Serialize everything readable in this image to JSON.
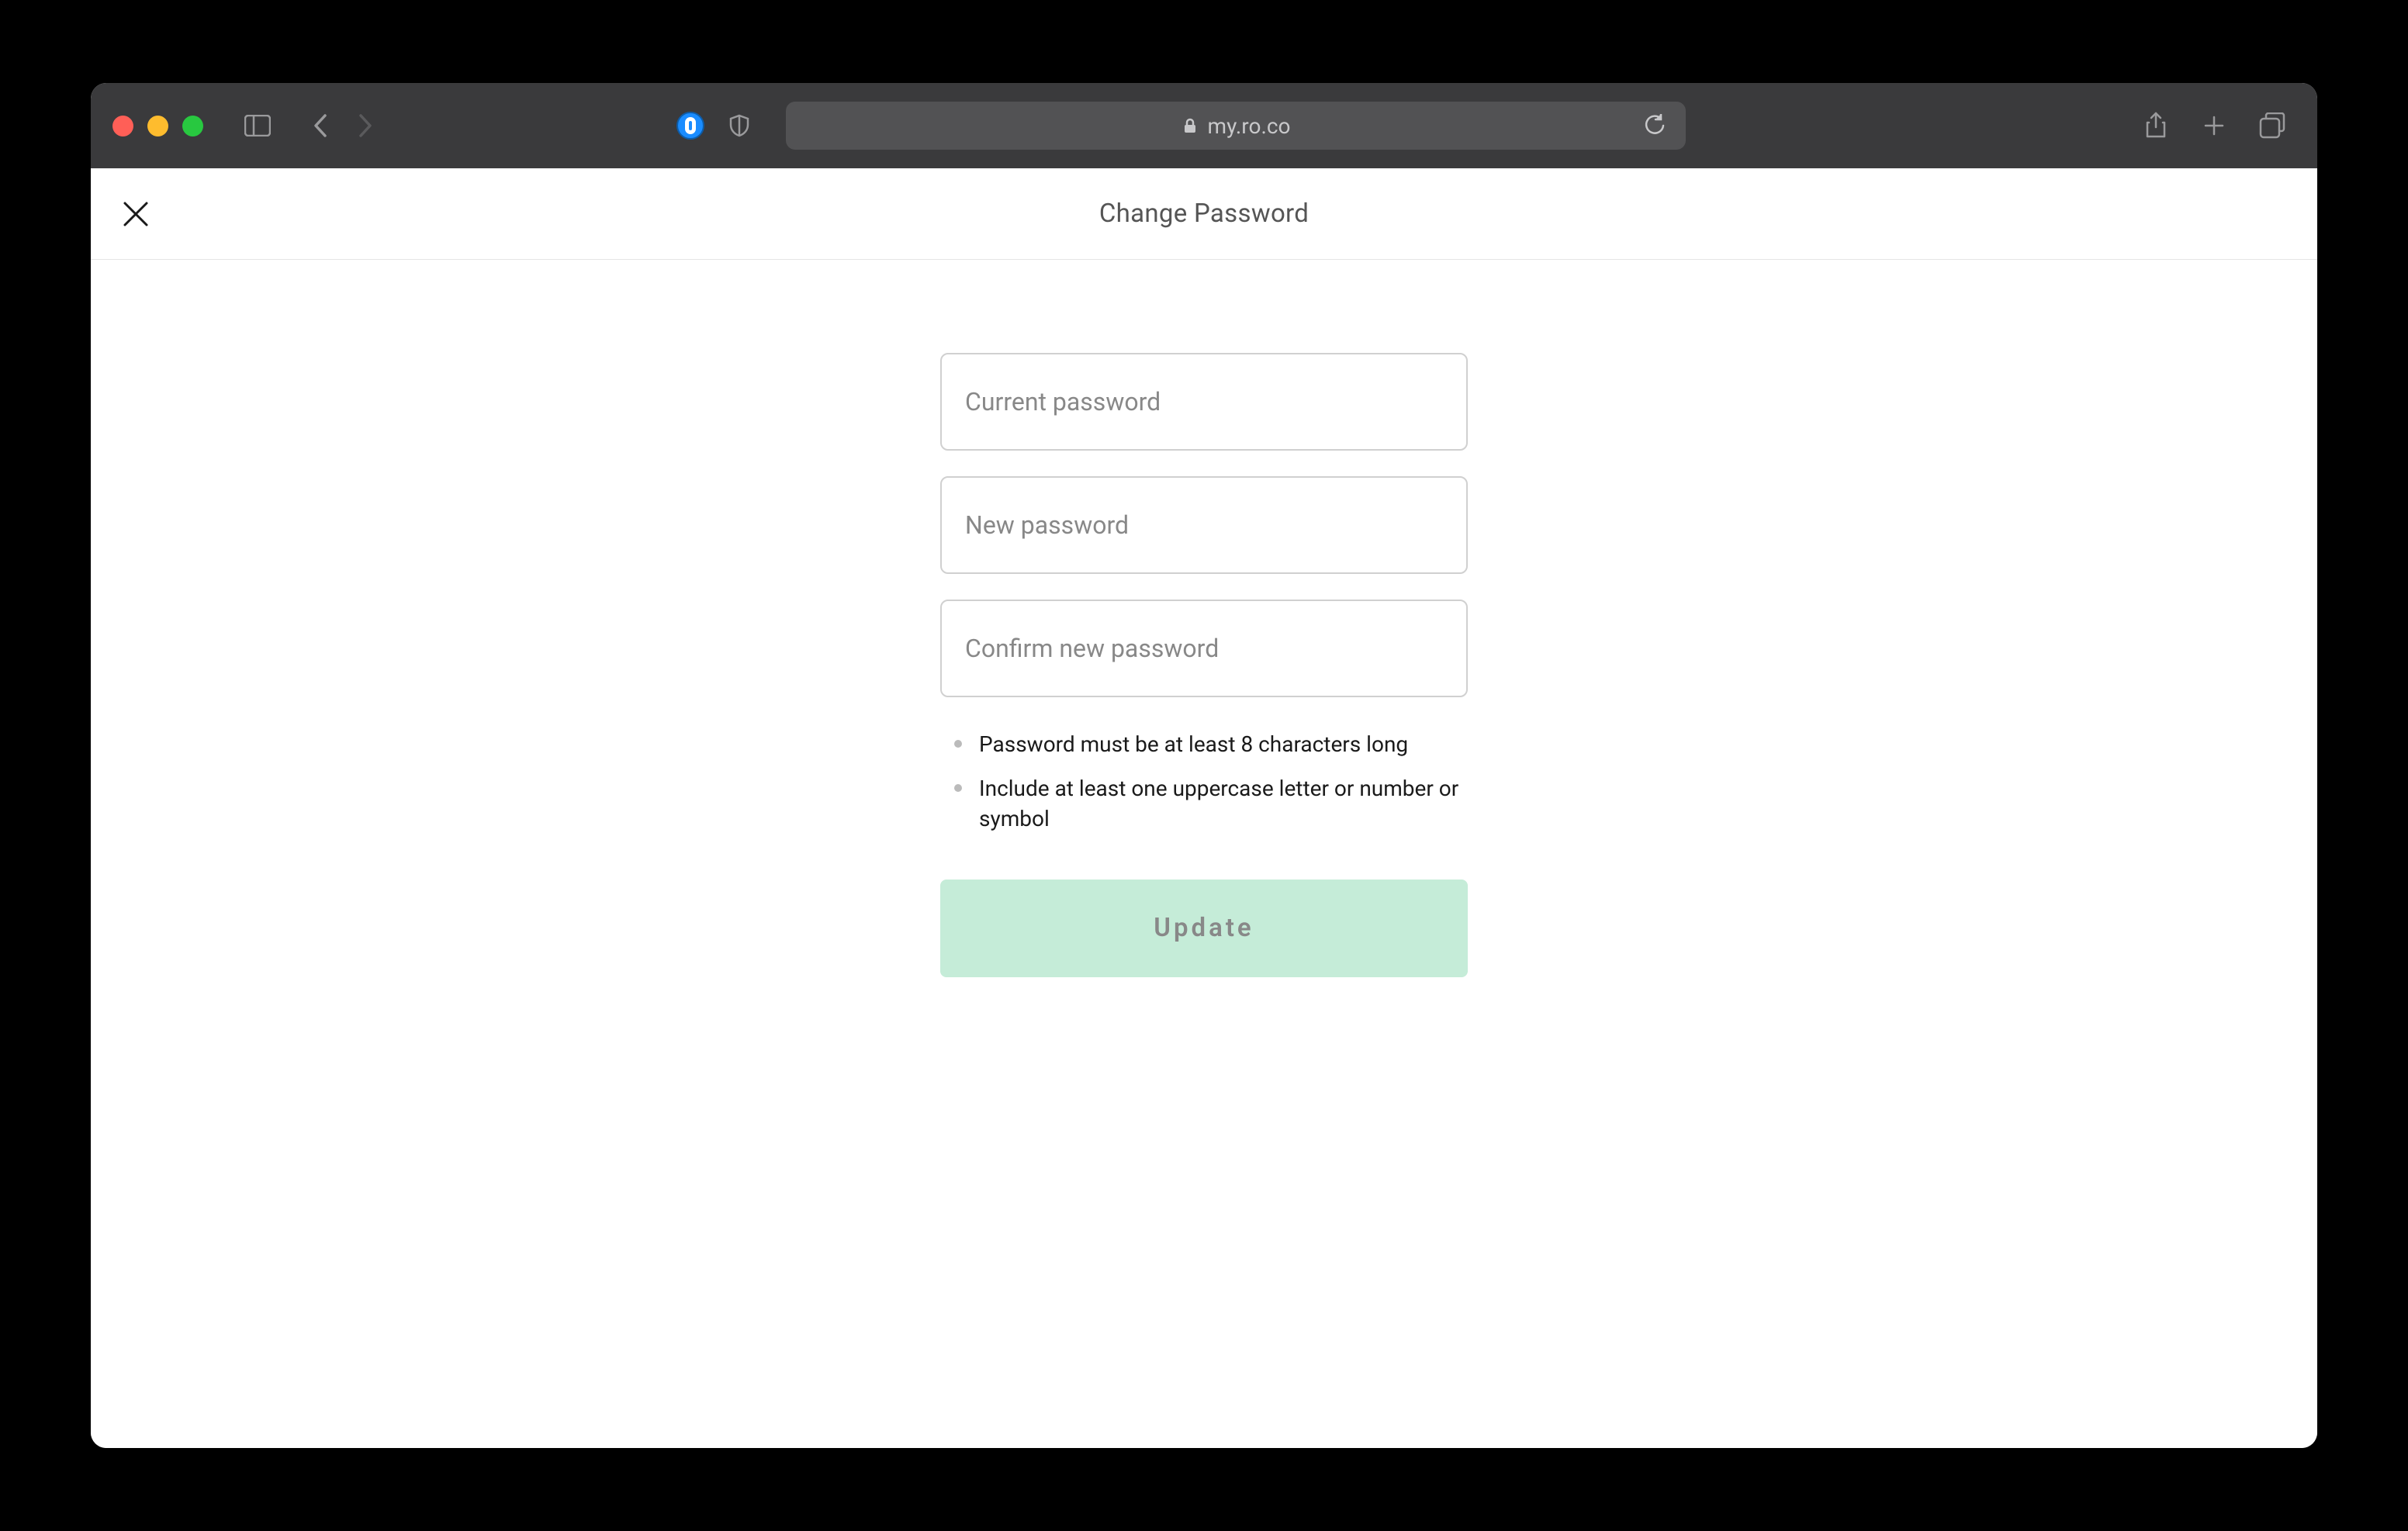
{
  "browser": {
    "url": "my.ro.co"
  },
  "header": {
    "title": "Change Password"
  },
  "form": {
    "current_password": {
      "placeholder": "Current password",
      "value": ""
    },
    "new_password": {
      "placeholder": "New password",
      "value": ""
    },
    "confirm_password": {
      "placeholder": "Confirm new password",
      "value": ""
    },
    "requirements": [
      "Password must be at least 8 characters long",
      "Include at least one uppercase letter or number or symbol"
    ],
    "submit_label": "Update"
  }
}
